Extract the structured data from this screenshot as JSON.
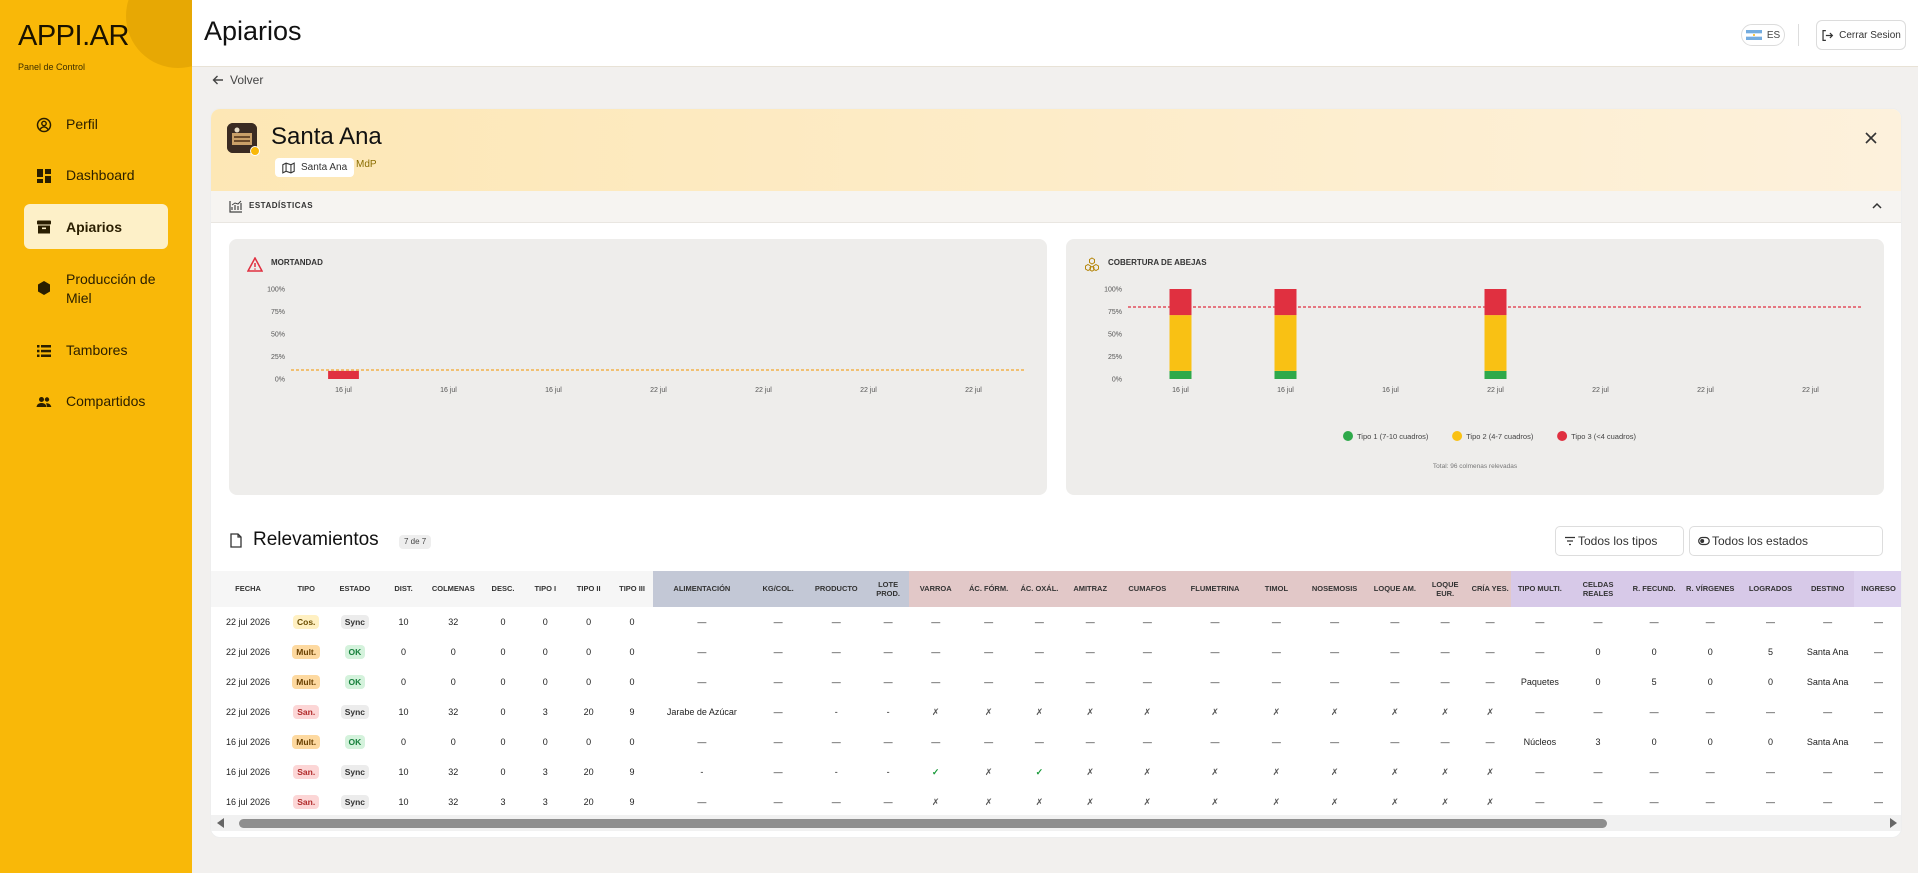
{
  "brand": {
    "name": "APPI.AR",
    "subtitle": "Panel de Control"
  },
  "sidebar": {
    "items": [
      {
        "label": "Perfil",
        "icon": "user-circle-icon",
        "active": false
      },
      {
        "label": "Dashboard",
        "icon": "dashboard-icon",
        "active": false
      },
      {
        "label": "Apiarios",
        "icon": "archive-box-icon",
        "active": true
      },
      {
        "label": "Producción de Miel",
        "icon": "hexagon-icon",
        "active": false
      },
      {
        "label": "Tambores",
        "icon": "list-icon",
        "active": false
      },
      {
        "label": "Compartidos",
        "icon": "people-icon",
        "active": false
      }
    ]
  },
  "header": {
    "title": "Apiarios",
    "lang": "ES",
    "logout_label": "Cerrar Sesion"
  },
  "back_label": "Volver",
  "apiary": {
    "name": "Santa Ana",
    "location_label": "Santa Ana",
    "tag": "MdP"
  },
  "stats": {
    "label": "ESTADÍSTICAS"
  },
  "charts": {
    "mortandad_title": "MORTANDAD",
    "cobertura_title": "COBERTURA DE ABEJAS",
    "cobertura_total": "Total: 96 colmenas relevadas"
  },
  "chart_data": [
    {
      "type": "bar",
      "title": "MORTANDAD",
      "categories": [
        "16 jul",
        "16 jul",
        "16 jul",
        "22 jul",
        "22 jul",
        "22 jul",
        "22 jul"
      ],
      "y_ticks": [
        "100%",
        "75%",
        "50%",
        "25%",
        "0%"
      ],
      "ylim": [
        0,
        100
      ],
      "values": [
        9,
        0,
        0,
        0,
        0,
        0,
        0
      ],
      "reference_line": 10,
      "colors": {
        "bar": "#e03040",
        "reference": "#f3a52a"
      }
    },
    {
      "type": "bar",
      "stacked": true,
      "title": "COBERTURA DE ABEJAS",
      "categories": [
        "16 jul",
        "16 jul",
        "16 jul",
        "22 jul",
        "22 jul",
        "22 jul",
        "22 jul"
      ],
      "y_ticks": [
        "100%",
        "75%",
        "50%",
        "25%",
        "0%"
      ],
      "ylim": [
        0,
        100
      ],
      "reference_line": 80,
      "series": [
        {
          "name": "Tipo 1 (7-10 cuadros)",
          "color": "#2ea94a",
          "values": [
            9,
            9,
            0,
            9,
            0,
            0,
            0
          ]
        },
        {
          "name": "Tipo 2 (4-7 cuadros)",
          "color": "#f9c114",
          "values": [
            62,
            62,
            0,
            62,
            0,
            0,
            0
          ]
        },
        {
          "name": "Tipo 3 (<4 cuadros)",
          "color": "#e03040",
          "values": [
            29,
            29,
            0,
            29,
            0,
            0,
            0
          ]
        }
      ],
      "legend_position": "bottom",
      "colors": {
        "reference": "#e03040"
      }
    }
  ],
  "relevamientos": {
    "title": "Relevamientos",
    "count": "7 de 7",
    "filter_types": "Todos los tipos",
    "filter_states": "Todos los estados",
    "columns": [
      {
        "label": "FECHA",
        "group": "base"
      },
      {
        "label": "TIPO",
        "group": "base"
      },
      {
        "label": "ESTADO",
        "group": "base"
      },
      {
        "label": "DIST.",
        "group": "base"
      },
      {
        "label": "COLMENAS",
        "group": "base"
      },
      {
        "label": "DESC.",
        "group": "base"
      },
      {
        "label": "TIPO I",
        "group": "base"
      },
      {
        "label": "TIPO II",
        "group": "base"
      },
      {
        "label": "TIPO III",
        "group": "base"
      },
      {
        "label": "ALIMENTACIÓN",
        "group": "alim"
      },
      {
        "label": "KG/COL.",
        "group": "alim"
      },
      {
        "label": "PRODUCTO",
        "group": "alim"
      },
      {
        "label": "LOTE PROD.",
        "group": "alim"
      },
      {
        "label": "VARROA",
        "group": "san"
      },
      {
        "label": "ÁC. FÓRM.",
        "group": "san"
      },
      {
        "label": "ÁC. OXÁL.",
        "group": "san"
      },
      {
        "label": "AMITRAZ",
        "group": "san"
      },
      {
        "label": "CUMAFOS",
        "group": "san"
      },
      {
        "label": "FLUMETRINA",
        "group": "san"
      },
      {
        "label": "TIMOL",
        "group": "san"
      },
      {
        "label": "NOSEMOSIS",
        "group": "san"
      },
      {
        "label": "LOQUE AM.",
        "group": "san"
      },
      {
        "label": "LOQUE EUR.",
        "group": "san"
      },
      {
        "label": "CRÍA YES.",
        "group": "san"
      },
      {
        "label": "TIPO MULTI.",
        "group": "mult"
      },
      {
        "label": "CELDAS REALES",
        "group": "mult"
      },
      {
        "label": "R. FECUND.",
        "group": "mult"
      },
      {
        "label": "R. VÍRGENES",
        "group": "mult"
      },
      {
        "label": "LOGRADOS",
        "group": "mult"
      },
      {
        "label": "DESTINO",
        "group": "mult"
      },
      {
        "label": "INGRESO",
        "group": "end"
      }
    ],
    "rows": [
      [
        "22 jul 2026",
        "Cos.",
        "Sync",
        "10",
        "32",
        "0",
        "0",
        "0",
        "0",
        "—",
        "—",
        "—",
        "—",
        "—",
        "—",
        "—",
        "—",
        "—",
        "—",
        "—",
        "—",
        "—",
        "—",
        "—",
        "—",
        "—",
        "—",
        "—",
        "—",
        "—",
        "—"
      ],
      [
        "22 jul 2026",
        "Mult.",
        "OK",
        "0",
        "0",
        "0",
        "0",
        "0",
        "0",
        "—",
        "—",
        "—",
        "—",
        "—",
        "—",
        "—",
        "—",
        "—",
        "—",
        "—",
        "—",
        "—",
        "—",
        "—",
        "—",
        "0",
        "0",
        "0",
        "5",
        "Santa Ana",
        "—"
      ],
      [
        "22 jul 2026",
        "Mult.",
        "OK",
        "0",
        "0",
        "0",
        "0",
        "0",
        "0",
        "—",
        "—",
        "—",
        "—",
        "—",
        "—",
        "—",
        "—",
        "—",
        "—",
        "—",
        "—",
        "—",
        "—",
        "—",
        "Paquetes",
        "0",
        "5",
        "0",
        "0",
        "Santa Ana",
        "—"
      ],
      [
        "22 jul 2026",
        "San.",
        "Sync",
        "10",
        "32",
        "0",
        "3",
        "20",
        "9",
        "Jarabe de Azúcar",
        "—",
        "-",
        "-",
        "✗",
        "✗",
        "✗",
        "✗",
        "✗",
        "✗",
        "✗",
        "✗",
        "✗",
        "✗",
        "✗",
        "—",
        "—",
        "—",
        "—",
        "—",
        "—",
        "—"
      ],
      [
        "16 jul 2026",
        "Mult.",
        "OK",
        "0",
        "0",
        "0",
        "0",
        "0",
        "0",
        "—",
        "—",
        "—",
        "—",
        "—",
        "—",
        "—",
        "—",
        "—",
        "—",
        "—",
        "—",
        "—",
        "—",
        "—",
        "Núcleos",
        "3",
        "0",
        "0",
        "0",
        "Santa Ana",
        "—"
      ],
      [
        "16 jul 2026",
        "San.",
        "Sync",
        "10",
        "32",
        "0",
        "3",
        "20",
        "9",
        "-",
        "—",
        "-",
        "-",
        "✓",
        "✗",
        "✓",
        "✗",
        "✗",
        "✗",
        "✗",
        "✗",
        "✗",
        "✗",
        "✗",
        "—",
        "—",
        "—",
        "—",
        "—",
        "—",
        "—"
      ],
      [
        "16 jul 2026",
        "San.",
        "Sync",
        "10",
        "32",
        "3",
        "3",
        "20",
        "9",
        "—",
        "—",
        "—",
        "—",
        "✗",
        "✗",
        "✗",
        "✗",
        "✗",
        "✗",
        "✗",
        "✗",
        "✗",
        "✗",
        "✗",
        "—",
        "—",
        "—",
        "—",
        "—",
        "—",
        "—"
      ]
    ]
  }
}
